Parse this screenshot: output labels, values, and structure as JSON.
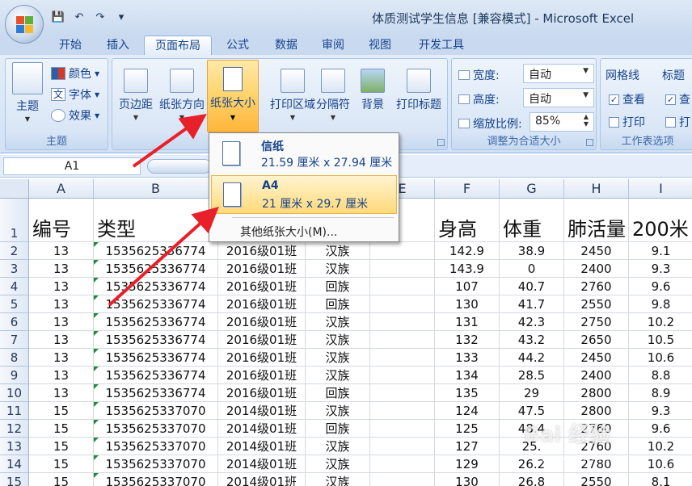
{
  "window": {
    "title": "体质测试学生信息  [兼容模式] - Microsoft Excel"
  },
  "tabs": [
    "开始",
    "插入",
    "页面布局",
    "公式",
    "数据",
    "审阅",
    "视图",
    "开发工具"
  ],
  "ribbon": {
    "theme_group": {
      "label": "主题",
      "themes_button": "主题",
      "colors": "颜色",
      "fonts": "字体",
      "effects": "效果"
    },
    "page_setup": {
      "margins": "页边距",
      "orientation": "纸张方向",
      "size": "纸张大小",
      "print_area": "打印区域",
      "breaks": "分隔符",
      "background": "背景",
      "print_titles": "打印标题"
    },
    "scale_group": {
      "label": "调整为合适大小",
      "width_label": "宽度:",
      "width_value": "自动",
      "height_label": "高度:",
      "height_value": "自动",
      "scale_label": "缩放比例:",
      "scale_value": "85%"
    },
    "sheet_options": {
      "label": "工作表选项",
      "gridlines": "网格线",
      "headings": "标题",
      "view": "查看",
      "print": "打印",
      "headings_view": "查",
      "headings_print": "打"
    }
  },
  "formula_bar": {
    "name_box": "A1"
  },
  "dropdown": {
    "items": [
      {
        "name": "信纸",
        "size": "21.59 厘米 x 27.94 厘米"
      },
      {
        "name": "A4",
        "size": "21 厘米 x 29.7 厘米"
      }
    ],
    "more": "其他纸张大小(M)..."
  },
  "columns": [
    "A",
    "B",
    "C",
    "D",
    "E",
    "F",
    "G",
    "H",
    "I"
  ],
  "header_row": [
    "编号",
    "类型",
    "",
    "",
    "别",
    "身高",
    "体重",
    "肺活量",
    "200米"
  ],
  "rows": [
    {
      "num": "2",
      "cells": [
        "13",
        "1535625336774",
        "2016级01班",
        "汉族",
        "",
        "142.9",
        "38.9",
        "2450",
        "9.1"
      ]
    },
    {
      "num": "3",
      "cells": [
        "13",
        "1535625336774",
        "2016级01班",
        "汉族",
        "",
        "143.9",
        "0",
        "2400",
        "9.3"
      ]
    },
    {
      "num": "4",
      "cells": [
        "13",
        "1535625336774",
        "2016级01班",
        "回族",
        "",
        "107",
        "40.7",
        "2760",
        "9.6"
      ]
    },
    {
      "num": "5",
      "cells": [
        "13",
        "1535625336774",
        "2016级01班",
        "回族",
        "",
        "130",
        "41.7",
        "2550",
        "9.8"
      ]
    },
    {
      "num": "6",
      "cells": [
        "13",
        "1535625336774",
        "2016级01班",
        "汉族",
        "",
        "131",
        "42.3",
        "2750",
        "10.2"
      ]
    },
    {
      "num": "7",
      "cells": [
        "13",
        "1535625336774",
        "2016级01班",
        "汉族",
        "",
        "132",
        "43.2",
        "2650",
        "10.5"
      ]
    },
    {
      "num": "8",
      "cells": [
        "13",
        "1535625336774",
        "2016级01班",
        "汉族",
        "",
        "133",
        "44.2",
        "2450",
        "10.6"
      ]
    },
    {
      "num": "9",
      "cells": [
        "13",
        "1535625336774",
        "2016级01班",
        "汉族",
        "",
        "134",
        "28.5",
        "2400",
        "8.8"
      ]
    },
    {
      "num": "10",
      "cells": [
        "13",
        "1535625336774",
        "2016级01班",
        "回族",
        "",
        "135",
        "29",
        "2800",
        "8.9"
      ]
    },
    {
      "num": "11",
      "cells": [
        "15",
        "1535625337070",
        "2014级01班",
        "汉族",
        "",
        "124",
        "47.5",
        "2800",
        "9.3"
      ]
    },
    {
      "num": "12",
      "cells": [
        "15",
        "1535625337070",
        "2014级01班",
        "回族",
        "",
        "125",
        "48.4",
        "2760",
        "9.6"
      ]
    },
    {
      "num": "13",
      "cells": [
        "15",
        "1535625337070",
        "2014级01班",
        "汉族",
        "",
        "127",
        "25.",
        "2760",
        "10.2"
      ]
    },
    {
      "num": "14",
      "cells": [
        "15",
        "1535625337070",
        "2014级01班",
        "汉族",
        "",
        "129",
        "26.2",
        "2780",
        "10.6"
      ]
    },
    {
      "num": "15",
      "cells": [
        "15",
        "1535625337070",
        "2014级01班",
        "汉族",
        "",
        "130",
        "26.8",
        "2550",
        "8.1"
      ]
    }
  ],
  "watermark": {
    "text": "Bai 经验",
    "sub": "jingyan.baidu.com"
  },
  "colors": {
    "accent": "#ffd36b",
    "arrow": "#e8202a"
  }
}
